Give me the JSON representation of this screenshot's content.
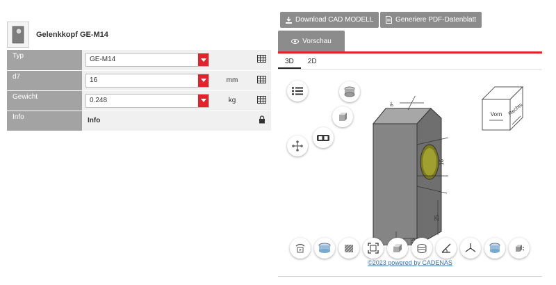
{
  "product": {
    "title": "Gelenkkopf GE-M14"
  },
  "attributes": [
    {
      "label": "Typ",
      "value": "GE-M14",
      "unit": ""
    },
    {
      "label": "d7",
      "value": "16",
      "unit": "mm"
    },
    {
      "label": "Gewicht",
      "value": "0.248",
      "unit": "kg"
    },
    {
      "label": "Info",
      "value": "Info",
      "unit": ""
    }
  ],
  "toolbar": {
    "download_label": "Download CAD MODELL",
    "pdf_label": "Generiere PDF-Datenblatt"
  },
  "preview_tab": {
    "label": "Vorschau"
  },
  "view_tabs": [
    "3D",
    "2D"
  ],
  "viewcube": {
    "front": "Vorn",
    "right": "Rechts"
  },
  "dims": {
    "d": "16",
    "h": "25",
    "w": "35",
    "angle": "9°"
  },
  "footer": {
    "link": "©2023 powered by CADENAS"
  },
  "colors": {
    "accent": "#e3222b",
    "button": "#8c8c8c",
    "label_bg": "#a3a3a3"
  }
}
